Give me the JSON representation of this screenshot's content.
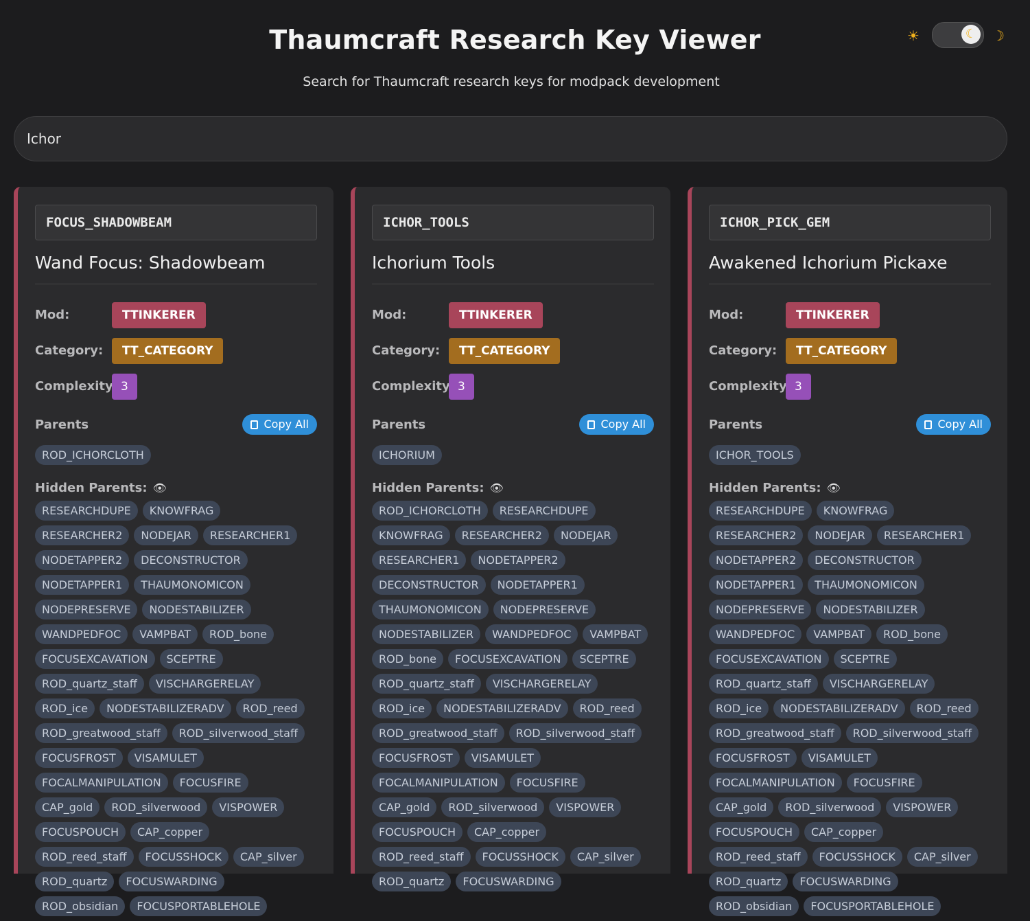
{
  "header": {
    "title": "Thaumcraft Research Key Viewer",
    "subtitle": "Search for Thaumcraft research keys for modpack development"
  },
  "theme": {
    "sun_icon": "☀",
    "moon_icon": "☽",
    "knob_icon": "☾",
    "mode": "dark"
  },
  "search": {
    "value": "Ichor",
    "placeholder": ""
  },
  "labels": {
    "mod": "Mod:",
    "category": "Category:",
    "complexity": "Complexity:",
    "parents": "Parents",
    "copy_all": "Copy All",
    "hidden_parents": "Hidden Parents:",
    "eye_icon": "👁"
  },
  "colors": {
    "mod_badge": "#a8455a",
    "category_badge": "#a36d1f",
    "complexity_badge": "#9650b8",
    "copy_button": "#2f8fd8",
    "card_accent": "#a8455a"
  },
  "cards": [
    {
      "key": "FOCUS_SHADOWBEAM",
      "name": "Wand Focus: Shadowbeam",
      "mod": "TTINKERER",
      "category": "TT_CATEGORY",
      "complexity": "3",
      "parents": [
        "ROD_ICHORCLOTH"
      ],
      "hidden_parents": [
        "RESEARCHDUPE",
        "KNOWFRAG",
        "RESEARCHER2",
        "NODEJAR",
        "RESEARCHER1",
        "NODETAPPER2",
        "DECONSTRUCTOR",
        "NODETAPPER1",
        "THAUMONOMICON",
        "NODEPRESERVE",
        "NODESTABILIZER",
        "WANDPEDFOC",
        "VAMPBAT",
        "ROD_bone",
        "FOCUSEXCAVATION",
        "SCEPTRE",
        "ROD_quartz_staff",
        "VISCHARGERELAY",
        "ROD_ice",
        "NODESTABILIZERADV",
        "ROD_reed",
        "ROD_greatwood_staff",
        "ROD_silverwood_staff",
        "FOCUSFROST",
        "VISAMULET",
        "FOCALMANIPULATION",
        "FOCUSFIRE",
        "CAP_gold",
        "ROD_silverwood",
        "VISPOWER",
        "FOCUSPOUCH",
        "CAP_copper",
        "ROD_reed_staff",
        "FOCUSSHOCK",
        "CAP_silver",
        "ROD_quartz",
        "FOCUSWARDING",
        "ROD_obsidian",
        "FOCUSPORTABLEHOLE"
      ]
    },
    {
      "key": "ICHOR_TOOLS",
      "name": "Ichorium Tools",
      "mod": "TTINKERER",
      "category": "TT_CATEGORY",
      "complexity": "3",
      "parents": [
        "ICHORIUM"
      ],
      "hidden_parents": [
        "ROD_ICHORCLOTH",
        "RESEARCHDUPE",
        "KNOWFRAG",
        "RESEARCHER2",
        "NODEJAR",
        "RESEARCHER1",
        "NODETAPPER2",
        "DECONSTRUCTOR",
        "NODETAPPER1",
        "THAUMONOMICON",
        "NODEPRESERVE",
        "NODESTABILIZER",
        "WANDPEDFOC",
        "VAMPBAT",
        "ROD_bone",
        "FOCUSEXCAVATION",
        "SCEPTRE",
        "ROD_quartz_staff",
        "VISCHARGERELAY",
        "ROD_ice",
        "NODESTABILIZERADV",
        "ROD_reed",
        "ROD_greatwood_staff",
        "ROD_silverwood_staff",
        "FOCUSFROST",
        "VISAMULET",
        "FOCALMANIPULATION",
        "FOCUSFIRE",
        "CAP_gold",
        "ROD_silverwood",
        "VISPOWER",
        "FOCUSPOUCH",
        "CAP_copper",
        "ROD_reed_staff",
        "FOCUSSHOCK",
        "CAP_silver",
        "ROD_quartz",
        "FOCUSWARDING"
      ]
    },
    {
      "key": "ICHOR_PICK_GEM",
      "name": "Awakened Ichorium Pickaxe",
      "mod": "TTINKERER",
      "category": "TT_CATEGORY",
      "complexity": "3",
      "parents": [
        "ICHOR_TOOLS"
      ],
      "hidden_parents": [
        "RESEARCHDUPE",
        "KNOWFRAG",
        "RESEARCHER2",
        "NODEJAR",
        "RESEARCHER1",
        "NODETAPPER2",
        "DECONSTRUCTOR",
        "NODETAPPER1",
        "THAUMONOMICON",
        "NODEPRESERVE",
        "NODESTABILIZER",
        "WANDPEDFOC",
        "VAMPBAT",
        "ROD_bone",
        "FOCUSEXCAVATION",
        "SCEPTRE",
        "ROD_quartz_staff",
        "VISCHARGERELAY",
        "ROD_ice",
        "NODESTABILIZERADV",
        "ROD_reed",
        "ROD_greatwood_staff",
        "ROD_silverwood_staff",
        "FOCUSFROST",
        "VISAMULET",
        "FOCALMANIPULATION",
        "FOCUSFIRE",
        "CAP_gold",
        "ROD_silverwood",
        "VISPOWER",
        "FOCUSPOUCH",
        "CAP_copper",
        "ROD_reed_staff",
        "FOCUSSHOCK",
        "CAP_silver",
        "ROD_quartz",
        "FOCUSWARDING",
        "ROD_obsidian",
        "FOCUSPORTABLEHOLE"
      ]
    }
  ]
}
